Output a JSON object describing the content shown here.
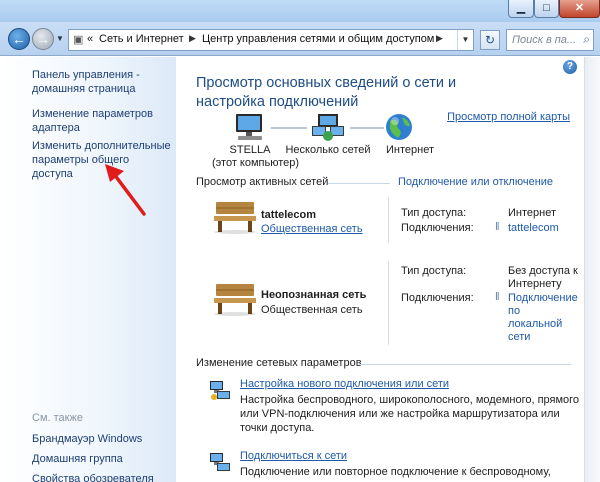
{
  "window": {
    "min_glyph": "▁",
    "max_glyph": "□",
    "close_glyph": "✕"
  },
  "nav": {
    "crumb_root": "«",
    "crumb1": "Сеть и Интернет",
    "crumb2": "Центр управления сетями и общим доступом",
    "refresh_glyph": "↻",
    "search_placeholder": "Поиск в па..."
  },
  "sidebar": {
    "items": [
      {
        "label": "Панель управления - домашняя страница"
      },
      {
        "label": "Изменение параметров адаптера"
      },
      {
        "label": "Изменить дополнительные параметры общего доступа"
      }
    ],
    "see_also": "См. также",
    "see_also_items": [
      {
        "label": "Брандмауэр Windows"
      },
      {
        "label": "Домашняя группа"
      },
      {
        "label": "Свойства обозревателя"
      }
    ]
  },
  "main": {
    "title": "Просмотр основных сведений о сети и настройка подключений",
    "full_map": "Просмотр полной карты",
    "map": {
      "node1_name": "STELLA",
      "node1_sub": "(этот компьютер)",
      "node2_name": "Несколько сетей",
      "node3_name": "Интернет"
    },
    "active_header": "Просмотр активных сетей",
    "connect_link": "Подключение или отключение",
    "networks": [
      {
        "name": "tattelecom",
        "type": "Общественная сеть",
        "access_label": "Тип доступа:",
        "access_value": "Интернет",
        "conn_label": "Подключения:",
        "conn_value": "tattelecom"
      },
      {
        "name": "Неопознанная сеть",
        "type": "Общественная сеть",
        "access_label": "Тип доступа:",
        "access_value": "Без доступа к Интернету",
        "conn_label": "Подключения:",
        "conn_value": "Подключение по локальной сети"
      }
    ],
    "change_header": "Изменение сетевых параметров",
    "tasks": [
      {
        "title": "Настройка нового подключения или сети",
        "desc": "Настройка беспроводного, широкополосного, модемного, прямого или VPN-подключения или же настройка маршрутизатора или точки доступа."
      },
      {
        "title": "Подключиться к сети",
        "desc": "Подключение или повторное подключение к беспроводному,"
      }
    ]
  },
  "colors": {
    "link": "#1e5aa8",
    "title": "#1e4c86",
    "annotation_arrow": "#e01b1b"
  }
}
